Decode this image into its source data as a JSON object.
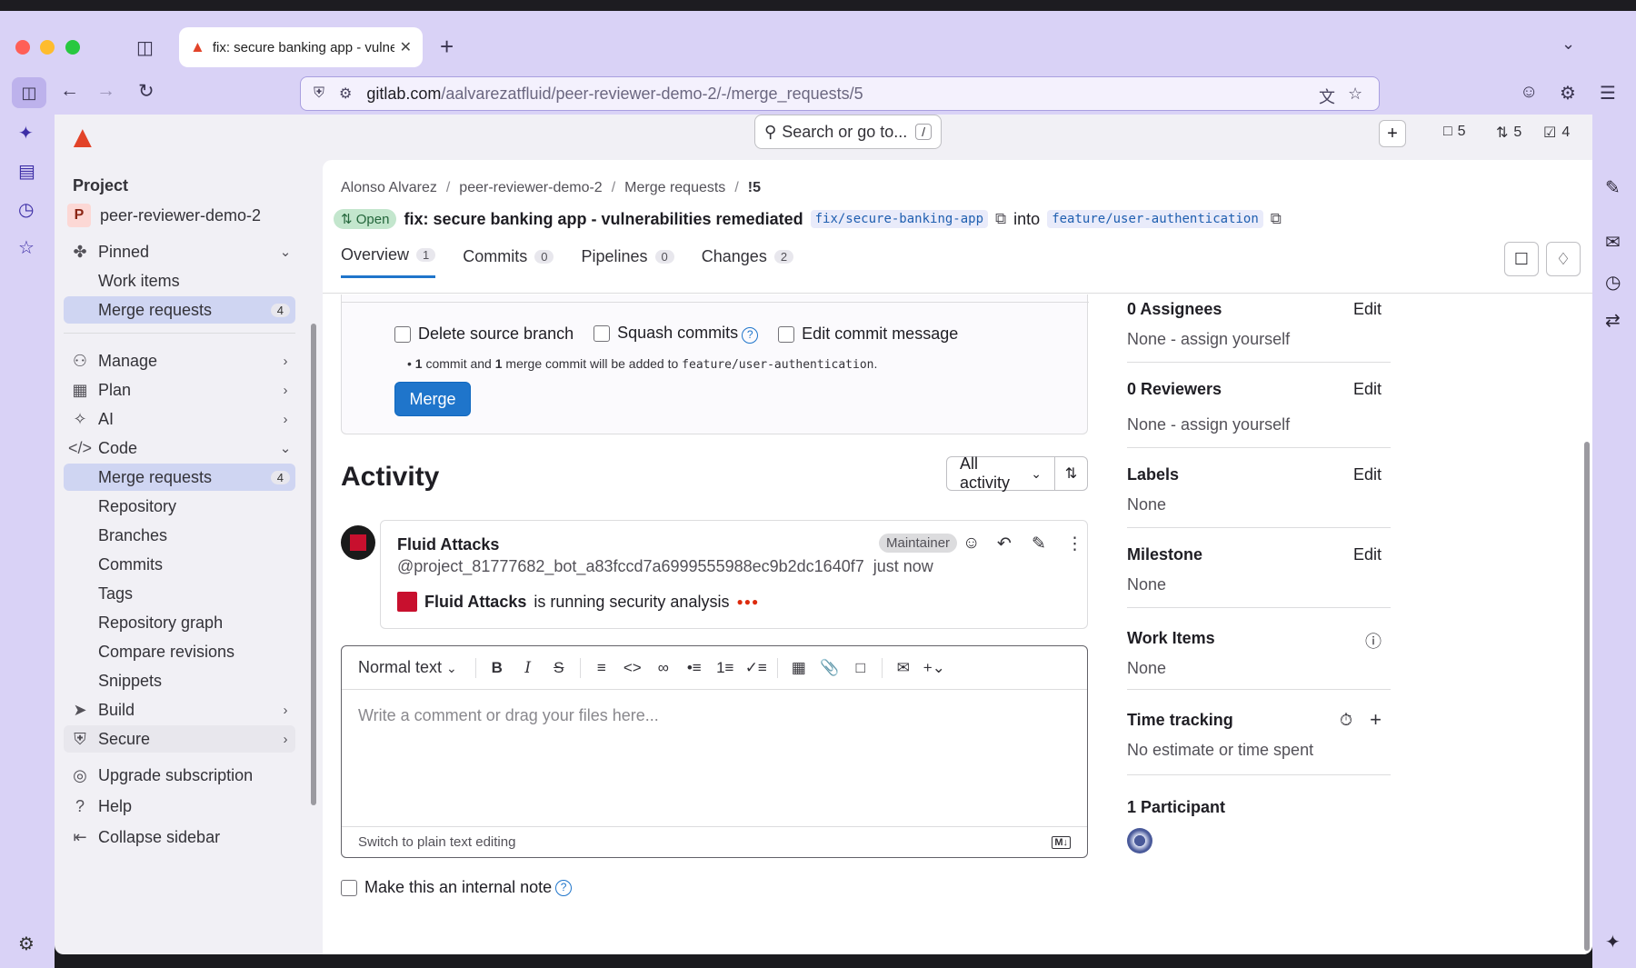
{
  "browser": {
    "tab_title": "fix: secure banking app - vulner",
    "url_host": "gitlab.com",
    "url_path": "/aalvarezatfluid/peer-reviewer-demo-2/-/merge_requests/5"
  },
  "topbar": {
    "search_placeholder": "Search or go to...",
    "search_kbd": "/",
    "counters": [
      {
        "icon": "issues-icon",
        "value": "5"
      },
      {
        "icon": "merge-request-icon",
        "value": "5"
      },
      {
        "icon": "todo-icon",
        "value": "4"
      }
    ]
  },
  "sidebar": {
    "section": "Project",
    "project_initial": "P",
    "project_name": "peer-reviewer-demo-2",
    "pinned": "Pinned",
    "pinned_items": [
      {
        "label": "Work items"
      },
      {
        "label": "Merge requests",
        "badge": "4"
      }
    ],
    "groups": [
      {
        "label": "Manage"
      },
      {
        "label": "Plan"
      },
      {
        "label": "AI"
      },
      {
        "label": "Code"
      }
    ],
    "code_items": [
      {
        "label": "Merge requests",
        "badge": "4"
      },
      {
        "label": "Repository"
      },
      {
        "label": "Branches"
      },
      {
        "label": "Commits"
      },
      {
        "label": "Tags"
      },
      {
        "label": "Repository graph"
      },
      {
        "label": "Compare revisions"
      },
      {
        "label": "Snippets"
      }
    ],
    "after_groups": [
      {
        "label": "Build"
      },
      {
        "label": "Secure"
      }
    ],
    "footer": [
      {
        "label": "Upgrade subscription"
      },
      {
        "label": "Help"
      },
      {
        "label": "Collapse sidebar"
      }
    ]
  },
  "breadcrumb": {
    "items": [
      "Alonso Alvarez",
      "peer-reviewer-demo-2",
      "Merge requests"
    ],
    "current": "!5"
  },
  "mr": {
    "status": "Open",
    "title": "fix: secure banking app - vulnerabilities remediated",
    "source_branch": "fix/secure-banking-app",
    "into": "into",
    "target_branch": "feature/user-authentication",
    "tabs": [
      {
        "label": "Overview",
        "count": "1"
      },
      {
        "label": "Commits",
        "count": "0"
      },
      {
        "label": "Pipelines",
        "count": "0"
      },
      {
        "label": "Changes",
        "count": "2"
      }
    ]
  },
  "merge_widget": {
    "opt_delete": "Delete source branch",
    "opt_squash": "Squash commits",
    "opt_edit": "Edit commit message",
    "note_n1": "1",
    "note_t1": " commit and ",
    "note_n2": "1",
    "note_t2": " merge commit will be added to ",
    "note_branch": "feature/user-authentication",
    "note_end": ".",
    "merge_label": "Merge"
  },
  "activity": {
    "heading": "Activity",
    "filter": "All activity"
  },
  "note": {
    "author": "Fluid Attacks",
    "handle": "@project_81777682_bot_a83fccd7a6999555988ec9b2dc1640f7",
    "time": "just now",
    "role": "Maintainer",
    "body_bold": "Fluid Attacks",
    "body_rest": "is running security analysis"
  },
  "editor": {
    "format": "Normal text",
    "placeholder": "Write a comment or drag your files here...",
    "switch": "Switch to plain text editing",
    "md_badge": "M↓"
  },
  "internal_note": "Make this an internal note",
  "right_sidebar": {
    "assignees_title": "0 Assignees",
    "assignees_val": "None - assign yourself",
    "reviewers_title": "0 Reviewers",
    "reviewers_val": "None - assign yourself",
    "labels_title": "Labels",
    "labels_val": "None",
    "milestone_title": "Milestone",
    "milestone_val": "None",
    "workitems_title": "Work Items",
    "workitems_val": "None",
    "time_title": "Time tracking",
    "time_val": "No estimate or time spent",
    "participants_title": "1 Participant",
    "edit": "Edit"
  }
}
